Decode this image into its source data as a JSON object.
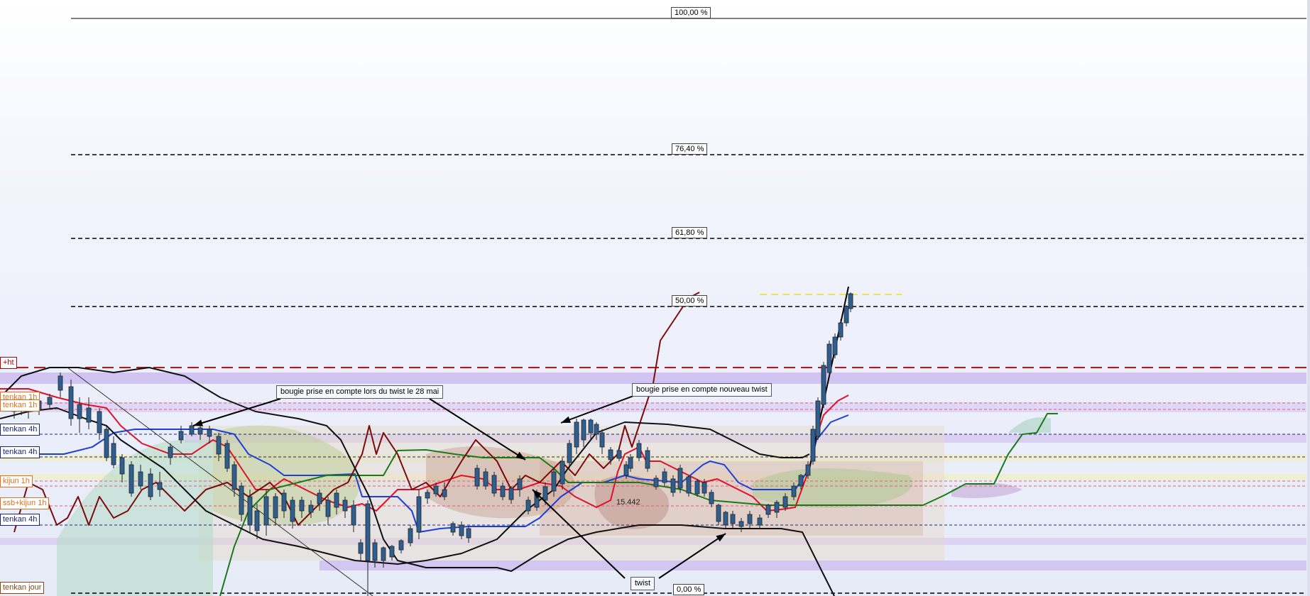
{
  "chart_data": {
    "type": "candlestick",
    "fib_levels": [
      {
        "label": "100,00 %",
        "pct": 100
      },
      {
        "label": "76,40 %",
        "pct": 76.4
      },
      {
        "label": "61,80 %",
        "pct": 61.8
      },
      {
        "label": "50,00 %",
        "pct": 50
      },
      {
        "label": "0,00 %",
        "pct": 0
      }
    ],
    "side_tags": [
      {
        "label": "+ht",
        "color": "#c00000"
      },
      {
        "label": "tenkan 1h",
        "color": "#e07020"
      },
      {
        "label": "tenkan 1h",
        "color": "#e07020"
      },
      {
        "label": "tenkan 4h",
        "color": "#1a237e"
      },
      {
        "label": "tenkan 4h",
        "color": "#1a237e"
      },
      {
        "label": "kijun 1h",
        "color": "#e07020"
      },
      {
        "label": "ssb+kijun 1h",
        "color": "#e07020"
      },
      {
        "label": "tenkan 4h",
        "color": "#1a237e"
      },
      {
        "label": "tenkan jour",
        "color": "#8b4513"
      }
    ],
    "annotations": [
      {
        "text": "bougie prise en compte lors du twist le 28 mai"
      },
      {
        "text": "bougie prise en compte  nouveau twist"
      },
      {
        "text": "twist"
      }
    ],
    "price_note": "15.442",
    "colors": {
      "tenkan": "#e0102a",
      "kijun": "#1e3fd6",
      "chikou": "#7a0c0c",
      "ssb": "#1a7a1a",
      "candle_bear": "#2f5f8f",
      "candle_bull": "#f8f8ee",
      "fib_line": "#000000",
      "resistance": "#d01010"
    }
  }
}
